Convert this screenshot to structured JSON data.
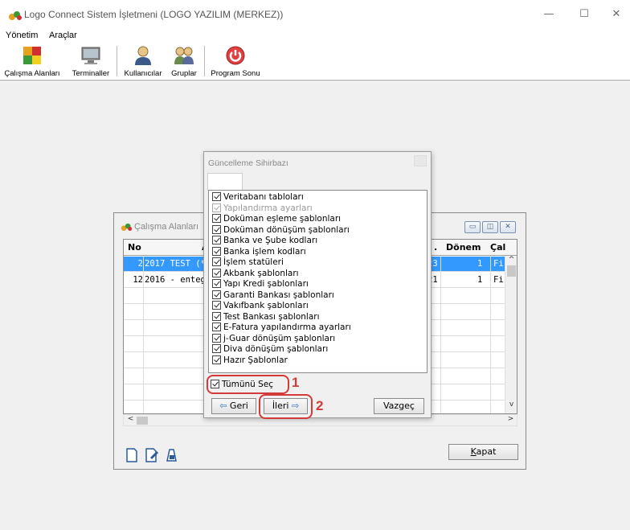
{
  "window": {
    "title": "Logo Connect Sistem İşletmeni (LOGO YAZILIM (MERKEZ))",
    "controls": {
      "minimize": "—",
      "maximize": "☐",
      "close": "✕"
    }
  },
  "menu": {
    "items": [
      "Yönetim",
      "Araçlar"
    ]
  },
  "toolbar": {
    "items": [
      {
        "label": "Çalışma Alanları",
        "icon": "workspaces-icon"
      },
      {
        "label": "Terminaller",
        "icon": "terminal-icon"
      },
      {
        "label": "Kullanıcılar",
        "icon": "user-icon"
      },
      {
        "label": "Gruplar",
        "icon": "group-icon"
      },
      {
        "label": "Program Sonu",
        "icon": "power-icon"
      }
    ]
  },
  "workspaces": {
    "title": "Çalışma Alanları",
    "columns": {
      "no": "No",
      "name": "A",
      "col3": ".",
      "donem": "Dönem",
      "cal": "Çal"
    },
    "rows": [
      {
        "no": "2",
        "name": "2017 TEST (*)",
        "col3": "23",
        "donem": "1",
        "cal": "Fi",
        "selected": true
      },
      {
        "no": "12",
        "name": "2016 - entegra",
        "col3": "21",
        "donem": "1",
        "cal": "Fi",
        "selected": false
      }
    ],
    "close_button": "Kapat",
    "close_accelerator": "K",
    "close_rest": "apat",
    "scroll": {
      "up": "^",
      "down": "v",
      "left": "<",
      "right": ">"
    }
  },
  "wizard": {
    "title": "Güncelleme Sihirbazı",
    "items": [
      {
        "label": "Veritabanı tabloları",
        "checked": true,
        "disabled": false
      },
      {
        "label": "Yapılandırma ayarları",
        "checked": true,
        "disabled": true
      },
      {
        "label": "Doküman eşleme şablonları",
        "checked": true,
        "disabled": false
      },
      {
        "label": "Doküman dönüşüm şablonları",
        "checked": true,
        "disabled": false
      },
      {
        "label": "Banka ve Şube kodları",
        "checked": true,
        "disabled": false
      },
      {
        "label": "Banka işlem kodları",
        "checked": true,
        "disabled": false
      },
      {
        "label": "İşlem statüleri",
        "checked": true,
        "disabled": false
      },
      {
        "label": "Akbank şablonları",
        "checked": true,
        "disabled": false
      },
      {
        "label": "Yapı Kredi şablonları",
        "checked": true,
        "disabled": false
      },
      {
        "label": "Garanti Bankası şablonları",
        "checked": true,
        "disabled": false
      },
      {
        "label": "Vakıfbank şablonları",
        "checked": true,
        "disabled": false
      },
      {
        "label": "Test Bankası şablonları",
        "checked": true,
        "disabled": false
      },
      {
        "label": "E-Fatura yapılandırma ayarları",
        "checked": true,
        "disabled": false
      },
      {
        "label": "j-Guar dönüşüm şablonları",
        "checked": true,
        "disabled": false
      },
      {
        "label": "Diva dönüşüm şablonları",
        "checked": true,
        "disabled": false
      },
      {
        "label": "Hazır Şablonlar",
        "checked": true,
        "disabled": false
      }
    ],
    "select_all": "Tümünü Seç",
    "back_button": "Geri",
    "next_button": "İleri",
    "cancel_button": "Vazgeç"
  },
  "annotations": {
    "step1": "1",
    "step2": "2",
    "color": "#d33b3b"
  },
  "colors": {
    "selection": "#3399ff",
    "accent_arrow": "#2d6fc4"
  }
}
